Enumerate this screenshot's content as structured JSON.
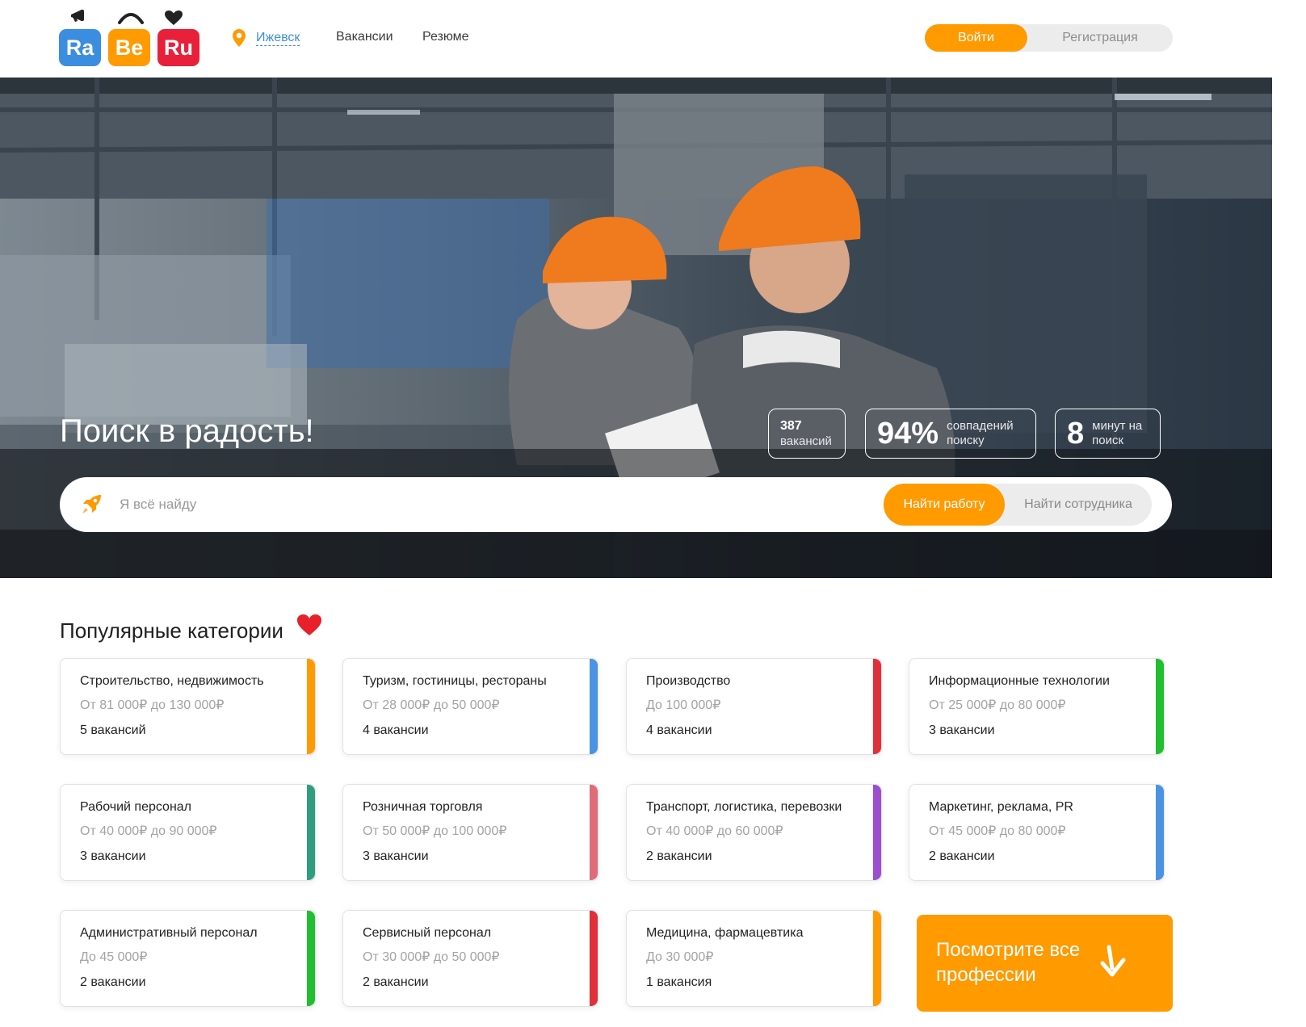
{
  "brand": {
    "logo_letters": [
      "Ra",
      "Be",
      "Ru"
    ],
    "colors": {
      "ra": "#3b8de0",
      "be": "#ff9a00",
      "ru": "#e8203a",
      "accent": "#ff9a00"
    }
  },
  "header": {
    "city_icon": "location-pin-icon",
    "city": "Ижевск",
    "nav": [
      "Вакансии",
      "Резюме"
    ],
    "login_label": "Войти",
    "register_label": "Регистрация"
  },
  "hero": {
    "title": "Поиск в радость!",
    "stats": [
      {
        "value": "387",
        "label": "вакансий"
      },
      {
        "value": "94%",
        "label": "совпадений поиску"
      },
      {
        "value": "8",
        "label": "минут на поиск"
      }
    ],
    "search": {
      "icon": "rocket-icon",
      "placeholder": "Я всё найду",
      "value": "",
      "find_job_label": "Найти работу",
      "find_employee_label": "Найти сотрудника"
    }
  },
  "categories": {
    "title": "Популярные категории",
    "title_icon": "heart-icon",
    "items": [
      {
        "name": "Строительство, недвижимость",
        "salary": "От 81 000₽ до 130 000₽",
        "count": "5 вакансий",
        "color": "#ff9a00"
      },
      {
        "name": "Туризм, гостиницы, рестораны",
        "salary": "От 28 000₽ до 50 000₽",
        "count": "4 вакансии",
        "color": "#4a93e2"
      },
      {
        "name": "Производство",
        "salary": "До 100 000₽",
        "count": "4 вакансии",
        "color": "#e0303a"
      },
      {
        "name": "Информационные технологии",
        "salary": "От 25 000₽ до 80 000₽",
        "count": "3 вакансии",
        "color": "#1fbf2f"
      },
      {
        "name": "Рабочий персонал",
        "salary": "От 40 000₽ до 90 000₽",
        "count": "3 вакансии",
        "color": "#2e9e7e"
      },
      {
        "name": "Розничная торговля",
        "salary": "От 50 000₽ до 100 000₽",
        "count": "3 вакансии",
        "color": "#e06b7a"
      },
      {
        "name": "Транспорт, логистика, перевозки",
        "salary": "От 40 000₽ до 60 000₽",
        "count": "2 вакансии",
        "color": "#9b4fd0"
      },
      {
        "name": "Маркетинг, реклама, PR",
        "salary": "От 45 000₽ до 80 000₽",
        "count": "2 вакансии",
        "color": "#4a93e2"
      },
      {
        "name": "Административный персонал",
        "salary": "До 45 000₽",
        "count": "2 вакансии",
        "color": "#1fbf2f"
      },
      {
        "name": "Сервисный персонал",
        "salary": "От 30 000₽ до 50 000₽",
        "count": "2 вакансии",
        "color": "#e0303a"
      },
      {
        "name": "Медицина, фармацевтика",
        "salary": "До 30 000₽",
        "count": "1 вакансия",
        "color": "#ff9a00"
      }
    ],
    "cta_label": "Посмотрите все профессии",
    "cta_icon": "arrow-down-icon"
  }
}
